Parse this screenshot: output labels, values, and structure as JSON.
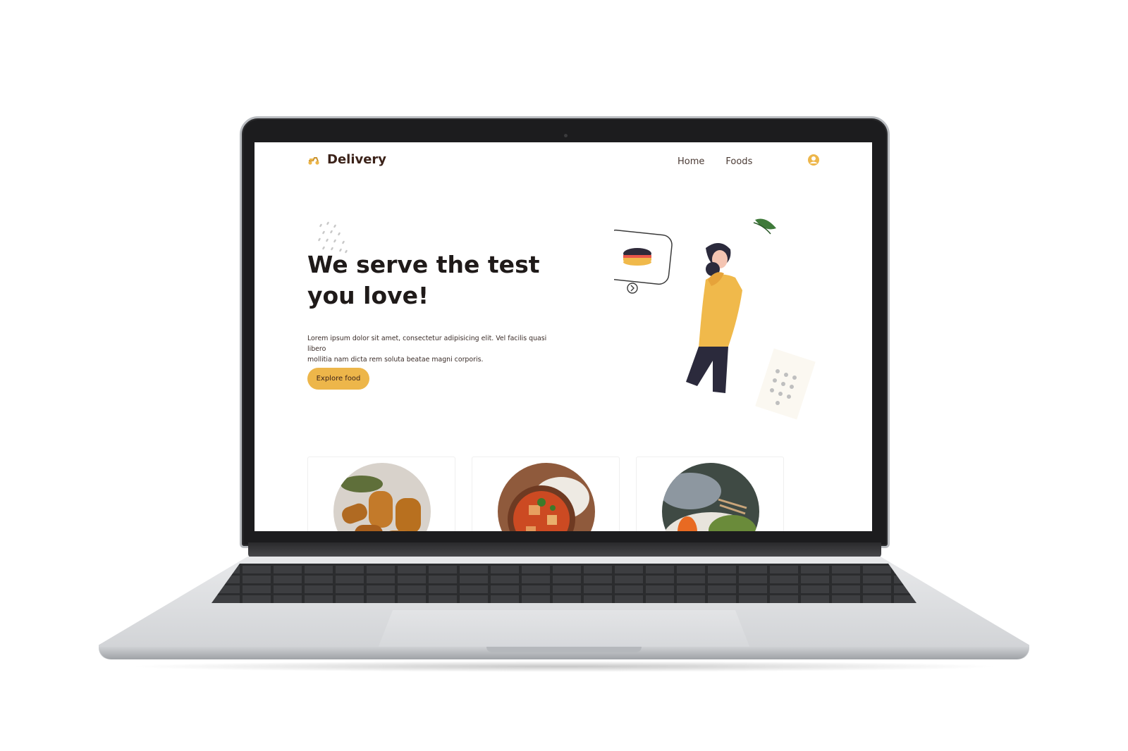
{
  "brand": {
    "name": "Delivery"
  },
  "nav": {
    "links": [
      "Home",
      "Foods"
    ]
  },
  "hero": {
    "title_line1": "We serve the test",
    "title_line2": "you love!",
    "description_line1": "Lorem ipsum dolor sit amet, consectetur adipisicing elit. Vel facilis quasi libero",
    "description_line2": "mollitia nam dicta rem soluta beatae magni corporis.",
    "cta_label": "Explore food"
  },
  "icons": {
    "logo": "scooter-icon",
    "user": "user-circle-icon",
    "bubble_arrow": "chevron-right-circle-icon"
  },
  "colors": {
    "accent": "#edb64a",
    "brand_text": "#3b2219",
    "title_text": "#1f1a19",
    "shirt": "#f0b94b",
    "pants": "#2b2a3c"
  },
  "food_cards": [
    {
      "dish": "fried croquettes"
    },
    {
      "dish": "rice with stew"
    },
    {
      "dish": "salad plate"
    }
  ]
}
